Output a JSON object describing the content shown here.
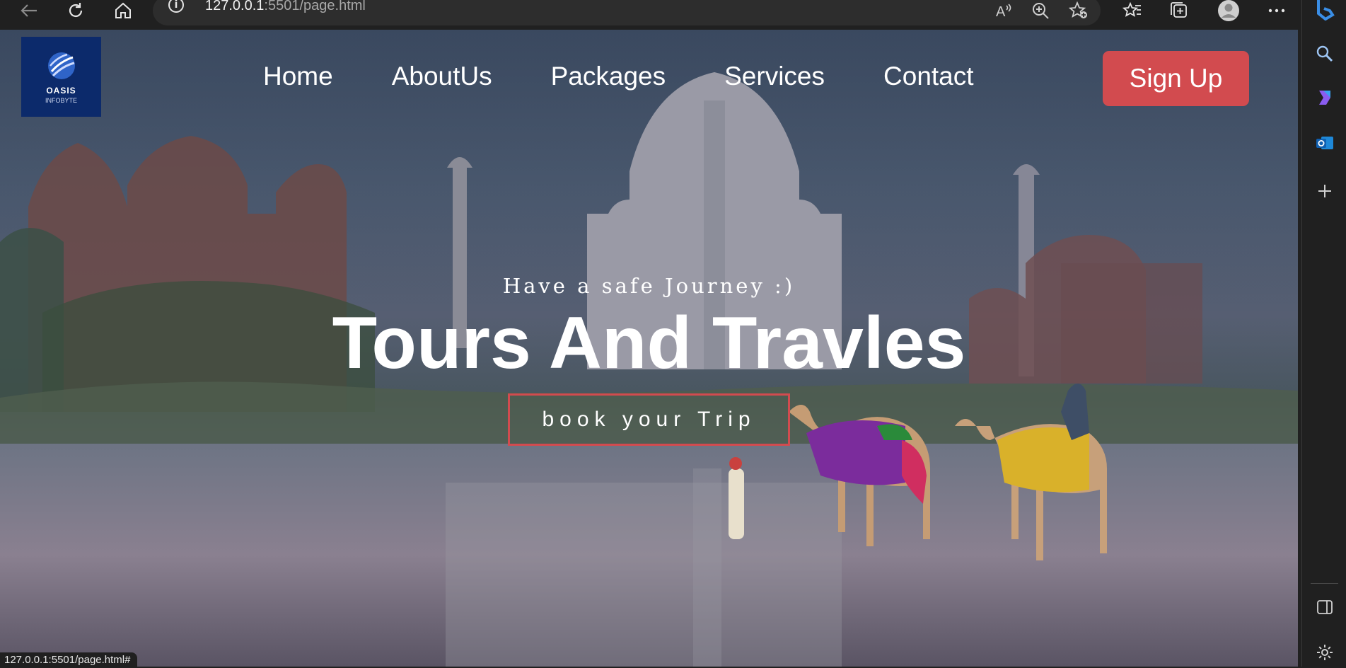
{
  "browser": {
    "url_host": "127.0.0.1",
    "url_path": ":5501/page.html",
    "status_bar_url": "127.0.0.1:5501/page.html#",
    "icons": [
      "back-icon",
      "refresh-icon",
      "home-icon",
      "info-icon",
      "read-aloud-icon",
      "zoom-icon",
      "add-favorite-icon",
      "favorites-icon",
      "collections-icon",
      "profile-icon",
      "more-icon",
      "bing-icon"
    ],
    "sidebar_icons": [
      "search-icon",
      "copilot-icon",
      "outlook-icon",
      "add-icon",
      "sidebar-toggle-icon",
      "settings-icon"
    ]
  },
  "site": {
    "logo": {
      "name": "OASIS",
      "sub": "INFOBYTE"
    },
    "nav": [
      "Home",
      "AboutUs",
      "Packages",
      "Services",
      "Contact"
    ],
    "signup_label": "Sign Up",
    "hero": {
      "subtitle": "Have a safe Journey :)",
      "title": "Tours And Travles",
      "cta": "book your Trip"
    },
    "colors": {
      "accent": "#d24b4f",
      "logo_bg": "#0c2a6b"
    }
  }
}
